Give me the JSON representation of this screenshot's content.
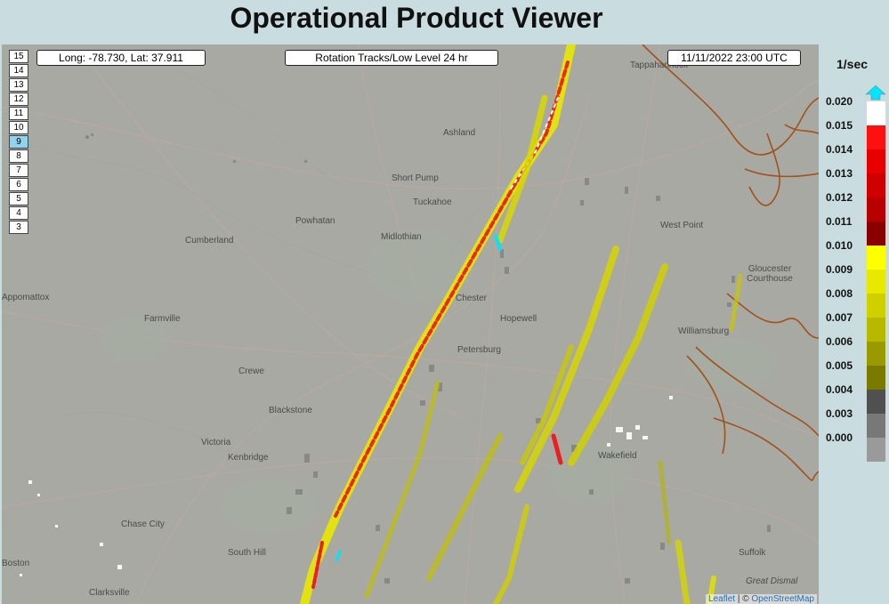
{
  "page_title": "Operational Product Viewer",
  "coordinates": {
    "text": "Long: -78.730,  Lat: 37.911"
  },
  "product": {
    "label": "Rotation Tracks/Low Level 24 hr"
  },
  "timestamp": {
    "label": "11/11/2022  23:00 UTC"
  },
  "levels": {
    "items": [
      "15",
      "14",
      "13",
      "12",
      "11",
      "10",
      "9",
      "8",
      "7",
      "6",
      "5",
      "4",
      "3"
    ],
    "active": "9"
  },
  "map": {
    "place_labels": [
      {
        "name": "Tappahannock"
      },
      {
        "name": "Ashland"
      },
      {
        "name": "Short Pump"
      },
      {
        "name": "Tuckahoe"
      },
      {
        "name": "Powhatan"
      },
      {
        "name": "Midlothian"
      },
      {
        "name": "Cumberland"
      },
      {
        "name": "Appomattox"
      },
      {
        "name": "Farmville"
      },
      {
        "name": "Chester"
      },
      {
        "name": "Hopewell"
      },
      {
        "name": "Petersburg"
      },
      {
        "name": "West Point"
      },
      {
        "name": "Gloucester Courthouse"
      },
      {
        "name": "Williamsburg"
      },
      {
        "name": "Crewe"
      },
      {
        "name": "Blackstone"
      },
      {
        "name": "Victoria"
      },
      {
        "name": "Kenbridge"
      },
      {
        "name": "Wakefield"
      },
      {
        "name": "Chase City"
      },
      {
        "name": "South Hill"
      },
      {
        "name": "Clarksville"
      },
      {
        "name": "Boston"
      },
      {
        "name": "Suffolk"
      },
      {
        "name": "Great Dismal"
      }
    ],
    "attribution": {
      "leaflet": "Leaflet",
      "separator": " | © ",
      "osm": "OpenStreetMap"
    }
  },
  "legend": {
    "unit": "1/sec",
    "labels": [
      "0.020",
      "0.015",
      "0.014",
      "0.013",
      "0.012",
      "0.011",
      "0.010",
      "0.009",
      "0.008",
      "0.007",
      "0.006",
      "0.005",
      "0.004",
      "0.003",
      "0.000"
    ],
    "colors": [
      "#ffffff",
      "#ff1010",
      "#e80000",
      "#d00000",
      "#b80000",
      "#8a0000",
      "#ffff00",
      "#e8e800",
      "#d0d000",
      "#b8b800",
      "#9a9a00",
      "#7a7a00",
      "#505050",
      "#787878",
      "#9a9a9a"
    ],
    "arrow_color": "#00e5ff"
  },
  "colors": {
    "water_border": "#a0521a",
    "track_yellow": "#f0ef1f",
    "track_red": "#e82020"
  }
}
